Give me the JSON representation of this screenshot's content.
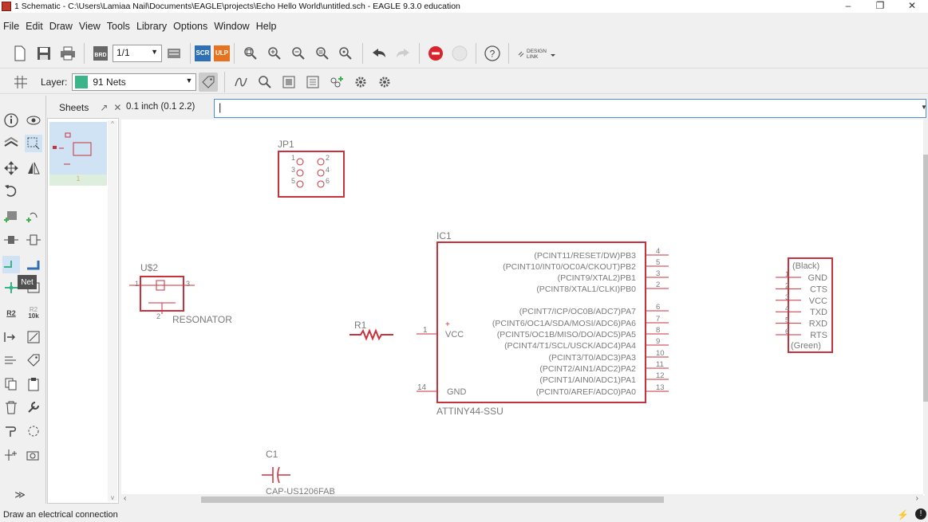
{
  "window": {
    "title": "1 Schematic - C:\\Users\\Lamiaa Nail\\Documents\\EAGLE\\projects\\Echo Hello World\\untitled.sch - EAGLE 9.3.0 education",
    "min": "–",
    "max": "❐",
    "close": "✕"
  },
  "menu": [
    "File",
    "Edit",
    "Draw",
    "View",
    "Tools",
    "Library",
    "Options",
    "Window",
    "Help"
  ],
  "toolbar": {
    "sheet_value": "1/1",
    "scr": "SCR",
    "ulp": "ULP",
    "design_link_line1": "DESIGN",
    "design_link_line2": "LINK",
    "help": "?"
  },
  "layer": {
    "label": "Layer:",
    "value": "91 Nets",
    "color": "#3cb48a"
  },
  "sheets_panel": {
    "title": "Sheets",
    "sheet_number": "1"
  },
  "coordinate_readout": "0.1 inch (0.1 2.2)",
  "command_input": "|",
  "tooltip": "Net",
  "status": "Draw an electrical connection",
  "left_tool_labels": {
    "r2": "R2",
    "r2_10k_a": "R2",
    "r2_10k_b": "10k",
    "r2_10k_c": "10k"
  },
  "schematic": {
    "jp1": {
      "name": "JP1",
      "pins": [
        "1",
        "2",
        "3",
        "4",
        "5",
        "6"
      ]
    },
    "u2": {
      "name": "U$2",
      "value": "RESONATOR",
      "pin1": "1",
      "pin2": "2",
      "pin3": "3"
    },
    "r1": {
      "name": "R1"
    },
    "ic1": {
      "name": "IC1",
      "value": "ATTINY44-SSU",
      "right_pins": [
        {
          "label": "(PCINT11/RESET/DW)PB3",
          "num": "4"
        },
        {
          "label": "(PCINT10/INT0/OC0A/CKOUT)PB2",
          "num": "5"
        },
        {
          "label": "(PCINT9/XTAL2)PB1",
          "num": "3"
        },
        {
          "label": "(PCINT8/XTAL1/CLKI)PB0",
          "num": "2"
        },
        {
          "label": "(PCINT7/ICP/OC0B/ADC7)PA7",
          "num": "6"
        },
        {
          "label": "(PCINT6/OC1A/SDA/MOSI/ADC6)PA6",
          "num": "7"
        },
        {
          "label": "(PCINT5/OC1B/MISO/DO/ADC5)PA5",
          "num": "8"
        },
        {
          "label": "(PCINT4/T1/SCL/USCK/ADC4)PA4",
          "num": "9"
        },
        {
          "label": "(PCINT3/T0/ADC3)PA3",
          "num": "10"
        },
        {
          "label": "(PCINT2/AIN1/ADC2)PA2",
          "num": "11"
        },
        {
          "label": "(PCINT1/AIN0/ADC1)PA1",
          "num": "12"
        },
        {
          "label": "(PCINT0/AREF/ADC0)PA0",
          "num": "13"
        }
      ],
      "vcc": "VCC",
      "vcc_num": "1",
      "gnd": "GND",
      "gnd_num": "14",
      "plus": "+"
    },
    "ftdi": {
      "top": "(Black)",
      "pins": [
        "GND",
        "CTS",
        "VCC",
        "TXD",
        "RXD",
        "RTS"
      ],
      "pin_nums": [
        "1",
        "2",
        "3",
        "4",
        "5",
        "6"
      ],
      "bottom": "(Green)"
    },
    "c1": {
      "name": "C1",
      "value": "CAP-US1206FAB"
    }
  },
  "colors": {
    "part": "#c8323c",
    "text": "#7a7a7a",
    "accent": "#4a90d9"
  }
}
